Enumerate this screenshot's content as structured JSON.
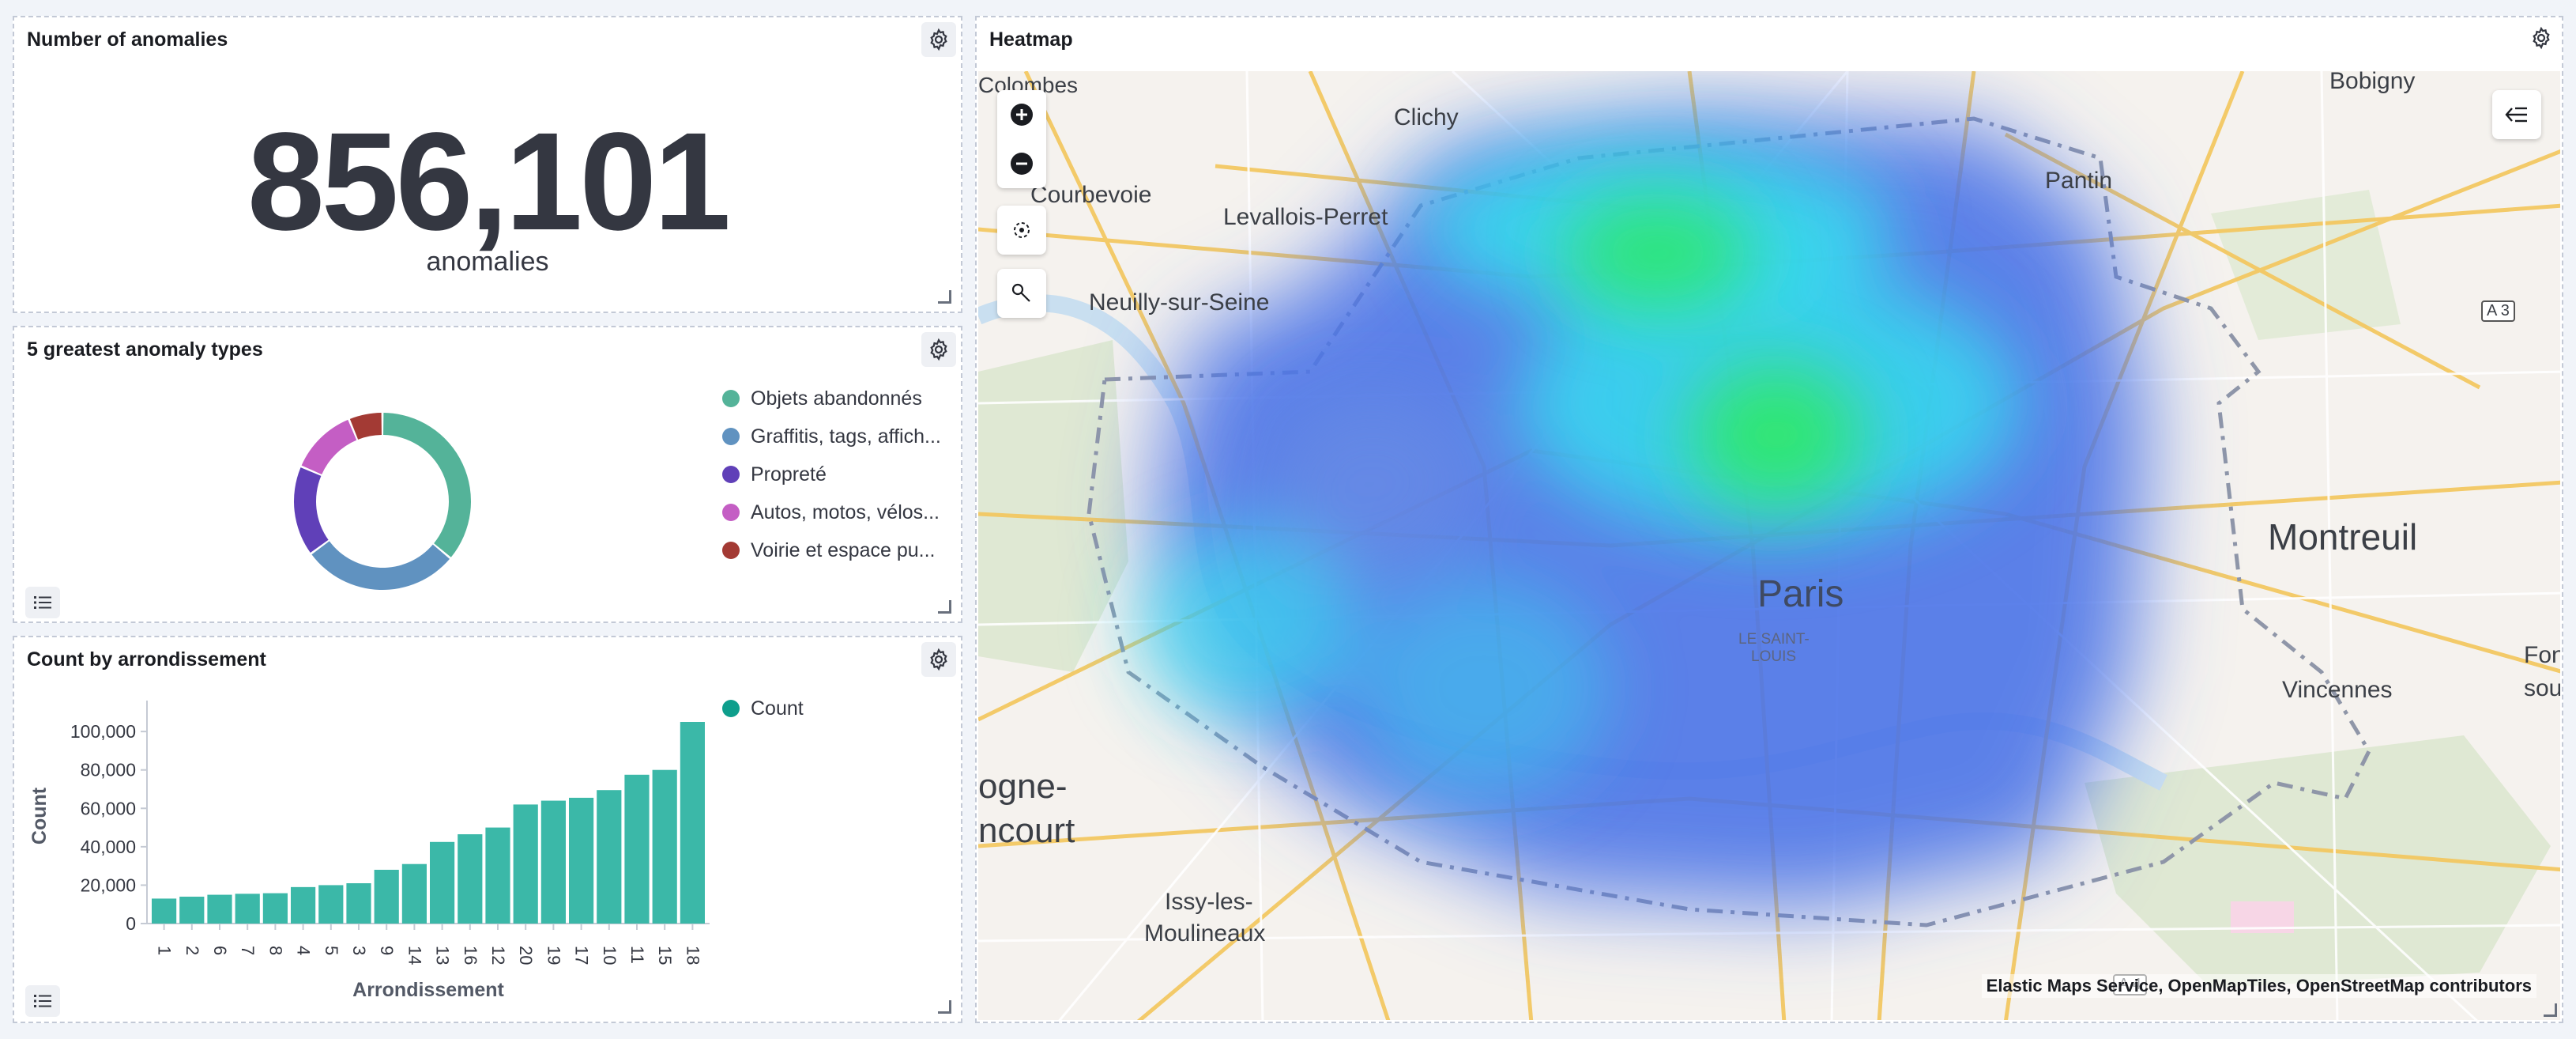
{
  "metric_panel": {
    "title": "Number of anomalies",
    "value": "856,101",
    "label": "anomalies"
  },
  "donut_panel": {
    "title": "5 greatest anomaly types",
    "legend": [
      {
        "label": "Objets abandonnés",
        "color": "#54b399"
      },
      {
        "label": "Graffitis, tags, affich...",
        "color": "#6092c0"
      },
      {
        "label": "Propreté",
        "color": "#6040b8"
      },
      {
        "label": "Autos, motos, vélos...",
        "color": "#c45ec4"
      },
      {
        "label": "Voirie et espace pu...",
        "color": "#a33a34"
      }
    ]
  },
  "donut_chart_data": {
    "type": "pie",
    "categories": [
      "Objets abandonnés",
      "Graffitis, tags, affich...",
      "Propreté",
      "Autos, motos, vélos...",
      "Voirie et espace pu..."
    ],
    "values": [
      35,
      28,
      16,
      12,
      6
    ]
  },
  "bar_panel": {
    "title": "Count by arrondissement",
    "legend_label": "Count",
    "color": "#3bb8a8"
  },
  "chart_data": {
    "type": "bar",
    "title": "Count by arrondissement",
    "xlabel": "Arrondissement",
    "ylabel": "Count",
    "categories": [
      "1",
      "2",
      "6",
      "7",
      "8",
      "4",
      "5",
      "3",
      "9",
      "14",
      "13",
      "16",
      "12",
      "20",
      "19",
      "17",
      "10",
      "11",
      "15",
      "18"
    ],
    "values": [
      13000,
      14000,
      15000,
      15500,
      15800,
      19000,
      20000,
      21000,
      28000,
      31000,
      42500,
      46500,
      50000,
      62000,
      64000,
      65500,
      69500,
      77500,
      80000,
      105000
    ],
    "yticks": [
      "0",
      "20,000",
      "40,000",
      "60,000",
      "80,000",
      "100,000"
    ],
    "ylim": [
      0,
      112000
    ]
  },
  "map_panel": {
    "title": "Heatmap",
    "attribution": "Elastic Maps Service, OpenMapTiles, OpenStreetMap contributors",
    "places": {
      "colombes": "Colombes",
      "bobigny": "Bobigny",
      "clichy": "Clichy",
      "courbevoie": "Courbevoie",
      "levallois": "Levallois-Perret",
      "pantin": "Pantin",
      "neuilly": "Neuilly-sur-Seine",
      "a3": "A 3",
      "paris": "Paris",
      "saint_louis_1": "LE SAINT-",
      "saint_louis_2": "LOUIS",
      "montreuil": "Montreuil",
      "font": "Font",
      "sou": "sou",
      "vincennes": "Vincennes",
      "ogne": "ogne-",
      "ncourt": "ncourt",
      "issy_1": "Issy-les-",
      "issy_2": "Moulineaux",
      "a4": "A 4"
    }
  }
}
